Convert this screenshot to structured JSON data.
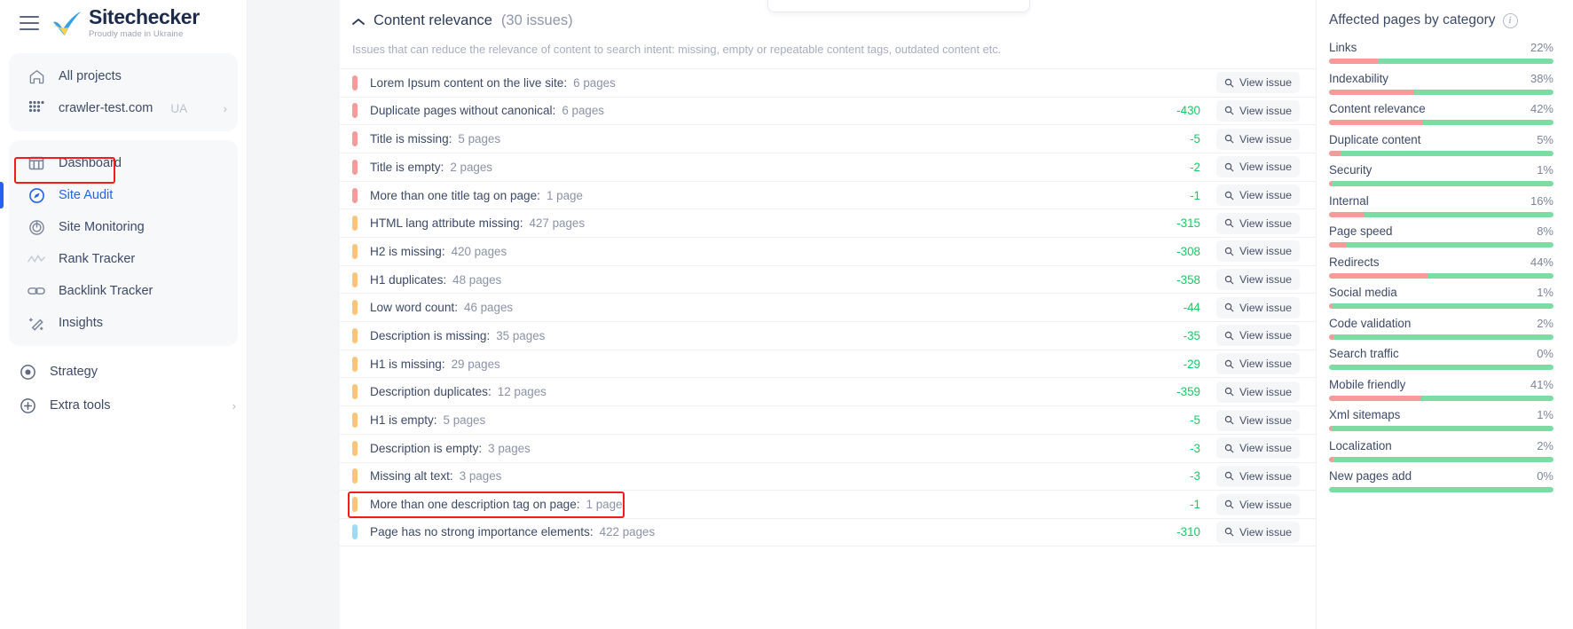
{
  "brand": {
    "name": "Sitechecker",
    "tagline": "Proudly made in Ukraine",
    "menu_icon": "hamburger-icon",
    "logo_icon": "ukraine-check-logo"
  },
  "sidebar": {
    "group1": [
      {
        "label": "All projects",
        "icon": "home-icon",
        "badge": "",
        "chevron": ""
      },
      {
        "label": "crawler-test.com",
        "icon": "grid-dots-icon",
        "badge": "UA",
        "chevron": "›"
      }
    ],
    "group2": [
      {
        "label": "Dashboard",
        "icon": "dashboard-icon",
        "active": false
      },
      {
        "label": "Site Audit",
        "icon": "site-audit-icon",
        "active": true
      },
      {
        "label": "Site Monitoring",
        "icon": "site-monitoring-icon",
        "active": false
      },
      {
        "label": "Rank Tracker",
        "icon": "rank-tracker-icon",
        "active": false
      },
      {
        "label": "Backlink Tracker",
        "icon": "backlink-tracker-icon",
        "active": false
      },
      {
        "label": "Insights",
        "icon": "insights-icon",
        "active": false
      }
    ],
    "group3": [
      {
        "label": "Strategy",
        "icon": "strategy-icon",
        "chevron": ""
      },
      {
        "label": "Extra tools",
        "icon": "plus-circle-icon",
        "chevron": "›"
      }
    ]
  },
  "section": {
    "caret": "⌃",
    "title": "Content relevance",
    "count": "(30 issues)",
    "description": "Issues that can reduce the relevance of content to search intent: missing, empty or repeatable content tags, outdated content etc."
  },
  "view_issue_label": "View issue",
  "view_issue_icon": "search-icon",
  "issues": [
    {
      "severity": "critical",
      "name": "Lorem Ipsum content on the live site:",
      "pages": "6 pages",
      "delta": "",
      "highlight": false
    },
    {
      "severity": "critical",
      "name": "Duplicate pages without canonical:",
      "pages": "6 pages",
      "delta": "-430",
      "highlight": false
    },
    {
      "severity": "critical",
      "name": "Title is missing:",
      "pages": "5 pages",
      "delta": "-5",
      "highlight": false
    },
    {
      "severity": "critical",
      "name": "Title is empty:",
      "pages": "2 pages",
      "delta": "-2",
      "highlight": false
    },
    {
      "severity": "critical",
      "name": "More than one title tag on page:",
      "pages": "1 page",
      "delta": "-1",
      "highlight": false
    },
    {
      "severity": "warning",
      "name": "HTML lang attribute missing:",
      "pages": "427 pages",
      "delta": "-315",
      "highlight": false
    },
    {
      "severity": "warning",
      "name": "H2 is missing:",
      "pages": "420 pages",
      "delta": "-308",
      "highlight": false
    },
    {
      "severity": "warning",
      "name": "H1 duplicates:",
      "pages": "48 pages",
      "delta": "-358",
      "highlight": false
    },
    {
      "severity": "warning",
      "name": "Low word count:",
      "pages": "46 pages",
      "delta": "-44",
      "highlight": false
    },
    {
      "severity": "warning",
      "name": "Description is missing:",
      "pages": "35 pages",
      "delta": "-35",
      "highlight": false
    },
    {
      "severity": "warning",
      "name": "H1 is missing:",
      "pages": "29 pages",
      "delta": "-29",
      "highlight": false
    },
    {
      "severity": "warning",
      "name": "Description duplicates:",
      "pages": "12 pages",
      "delta": "-359",
      "highlight": false
    },
    {
      "severity": "warning",
      "name": "H1 is empty:",
      "pages": "5 pages",
      "delta": "-5",
      "highlight": false
    },
    {
      "severity": "warning",
      "name": "Description is empty:",
      "pages": "3 pages",
      "delta": "-3",
      "highlight": false
    },
    {
      "severity": "warning",
      "name": "Missing alt text:",
      "pages": "3 pages",
      "delta": "-3",
      "highlight": false
    },
    {
      "severity": "warning",
      "name": "More than one description tag on page:",
      "pages": "1 page",
      "delta": "-1",
      "highlight": true
    },
    {
      "severity": "info",
      "name": "Page has no strong importance elements:",
      "pages": "422 pages",
      "delta": "-310",
      "highlight": false
    }
  ],
  "right_panel": {
    "title": "Affected pages by category",
    "info_icon": "info-icon",
    "categories": [
      {
        "name": "Links",
        "pct": "22%",
        "value": 22
      },
      {
        "name": "Indexability",
        "pct": "38%",
        "value": 38
      },
      {
        "name": "Content relevance",
        "pct": "42%",
        "value": 42
      },
      {
        "name": "Duplicate content",
        "pct": "5%",
        "value": 5
      },
      {
        "name": "Security",
        "pct": "1%",
        "value": 1
      },
      {
        "name": "Internal",
        "pct": "16%",
        "value": 16
      },
      {
        "name": "Page speed",
        "pct": "8%",
        "value": 8
      },
      {
        "name": "Redirects",
        "pct": "44%",
        "value": 44
      },
      {
        "name": "Social media",
        "pct": "1%",
        "value": 1
      },
      {
        "name": "Code validation",
        "pct": "2%",
        "value": 2
      },
      {
        "name": "Search traffic",
        "pct": "0%",
        "value": 0
      },
      {
        "name": "Mobile friendly",
        "pct": "41%",
        "value": 41
      },
      {
        "name": "Xml sitemaps",
        "pct": "1%",
        "value": 1
      },
      {
        "name": "Localization",
        "pct": "2%",
        "value": 2
      },
      {
        "name": "New pages add",
        "pct": "0%",
        "value": 0
      }
    ]
  },
  "colors": {
    "accent": "#2563eb",
    "critical": "#f79a9a",
    "warning": "#fbc47b",
    "info": "#9fd9f6",
    "delta_green": "#18c964",
    "bar_healthy": "#7ddba4",
    "bar_affected": "#f79a9a",
    "highlight": "#f51b1b"
  }
}
